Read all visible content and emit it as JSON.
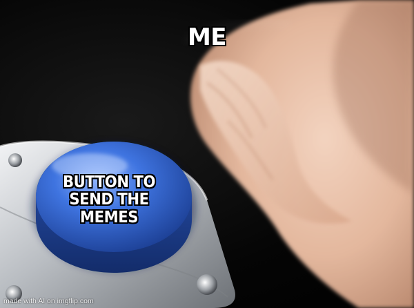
{
  "meme": {
    "template": "Blank Nut Button",
    "captions": {
      "top": "ME",
      "button": "BUTTON TO SEND THE MEMES"
    },
    "watermark": "made with AI on imgflip.com",
    "colors": {
      "background": "#000000",
      "button_blue": "#3a6fd8",
      "housing_silver": "#c9ccd0",
      "skin": "#e7bfa6",
      "caption_text": "#ffffff"
    }
  }
}
